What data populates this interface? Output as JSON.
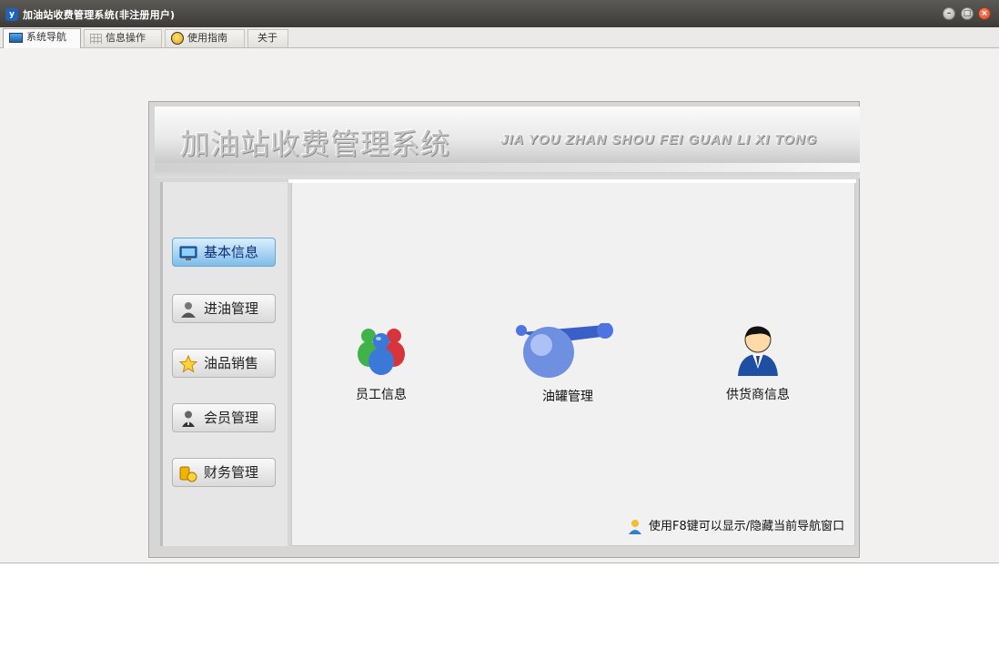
{
  "window": {
    "title": "加油站收费管理系统(非注册用户)",
    "app_icon": "y",
    "controls": {
      "minimize": "–",
      "maximize": "□",
      "close": "×"
    }
  },
  "tabs": [
    {
      "label": "系统导航",
      "icon": "monitor-icon",
      "active": true
    },
    {
      "label": "信息操作",
      "icon": "grid-icon",
      "active": false
    },
    {
      "label": "使用指南",
      "icon": "help-icon",
      "active": false
    },
    {
      "label": "关于",
      "icon": "",
      "active": false
    }
  ],
  "banner": {
    "title_cn": "加油站收费管理系统",
    "title_en": "JIA YOU ZHAN SHOU FEI GUAN LI XI TONG"
  },
  "sidebar": {
    "items": [
      {
        "label": "基本信息",
        "icon": "monitor-icon",
        "active": true
      },
      {
        "label": "进油管理",
        "icon": "user-icon",
        "active": false
      },
      {
        "label": "油品销售",
        "icon": "star-icon",
        "active": false
      },
      {
        "label": "会员管理",
        "icon": "member-icon",
        "active": false
      },
      {
        "label": "财务管理",
        "icon": "coins-icon",
        "active": false
      }
    ]
  },
  "content": {
    "items": [
      {
        "label": "员工信息",
        "icon": "staff-group-icon"
      },
      {
        "label": "油罐管理",
        "icon": "tank-icon"
      },
      {
        "label": "供货商信息",
        "icon": "supplier-person-icon"
      }
    ],
    "hint": "使用F8键可以显示/隐藏当前导航窗口"
  },
  "colors": {
    "accent": "#7fbde8",
    "titlebar": "#3c3b37",
    "close": "#d94a24"
  }
}
